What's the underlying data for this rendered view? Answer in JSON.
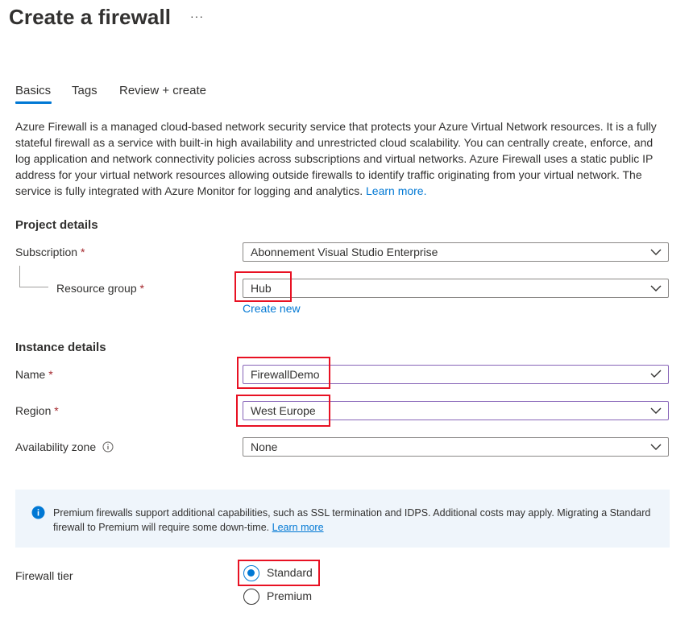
{
  "header": {
    "title": "Create a firewall",
    "more_label": "···"
  },
  "tabs": [
    {
      "label": "Basics",
      "active": true
    },
    {
      "label": "Tags",
      "active": false
    },
    {
      "label": "Review + create",
      "active": false
    }
  ],
  "description": {
    "text": "Azure Firewall is a managed cloud-based network security service that protects your Azure Virtual Network resources. It is a fully stateful firewall as a service with built-in high availability and unrestricted cloud scalability. You can centrally create, enforce, and log application and network connectivity policies across subscriptions and virtual networks. Azure Firewall uses a static public IP address for your virtual network resources allowing outside firewalls to identify traffic originating from your virtual network. The service is fully integrated with Azure Monitor for logging and analytics.",
    "link": "Learn more."
  },
  "project_details": {
    "heading": "Project details",
    "subscription": {
      "label": "Subscription",
      "required_mark": "*",
      "value": "Abonnement Visual Studio Enterprise"
    },
    "resource_group": {
      "label": "Resource group",
      "required_mark": "*",
      "value": "Hub",
      "create_new": "Create new"
    }
  },
  "instance_details": {
    "heading": "Instance details",
    "name": {
      "label": "Name",
      "required_mark": "*",
      "value": "FirewallDemo"
    },
    "region": {
      "label": "Region",
      "required_mark": "*",
      "value": "West Europe"
    },
    "availability_zone": {
      "label": "Availability zone",
      "value": "None"
    }
  },
  "info_banner": {
    "text": "Premium firewalls support additional capabilities, such as SSL termination and IDPS. Additional costs may apply. Migrating a Standard firewall to Premium will require some down-time.",
    "link": "Learn more"
  },
  "firewall_tier": {
    "label": "Firewall tier",
    "options": [
      {
        "label": "Standard",
        "selected": true
      },
      {
        "label": "Premium",
        "selected": false
      }
    ]
  },
  "colors": {
    "accent": "#0078d4",
    "highlight": "#e81123",
    "required": "#a4262c",
    "info_bg": "#eff5fb"
  }
}
